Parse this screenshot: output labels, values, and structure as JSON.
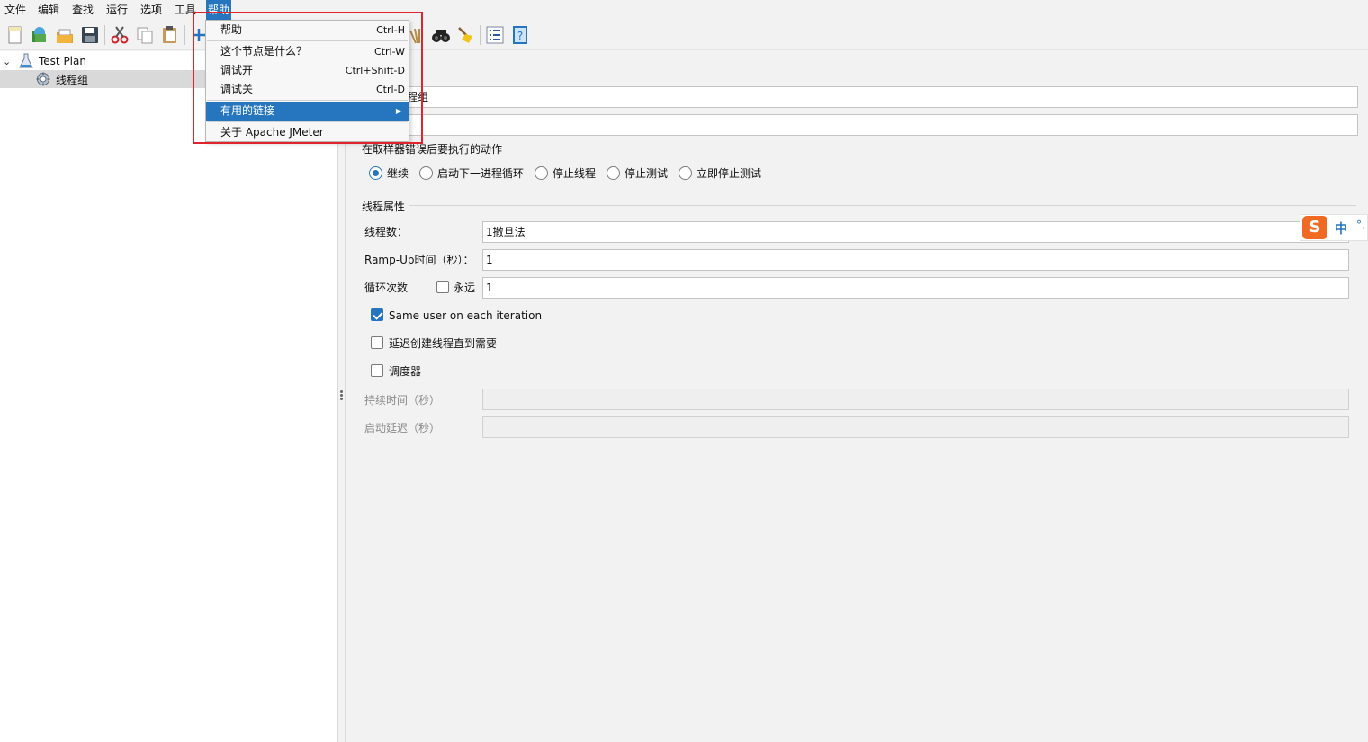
{
  "menubar": {
    "items": [
      "文件",
      "编辑",
      "查找",
      "运行",
      "选项",
      "工具",
      "帮助"
    ]
  },
  "help_menu": {
    "items": [
      {
        "label": "帮助",
        "shortcut": "Ctrl-H"
      },
      {
        "label": "这个节点是什么？",
        "shortcut": "Ctrl-W"
      },
      {
        "label": "调试开",
        "shortcut": "Ctrl+Shift-D"
      },
      {
        "label": "调试关",
        "shortcut": "Ctrl-D"
      },
      {
        "label": "有用的链接",
        "submenu_arrow": "▶"
      },
      {
        "label": "关于 Apache JMeter"
      }
    ]
  },
  "toolbar": {
    "icons": [
      "new-icon",
      "templates-icon",
      "open-icon",
      "save-icon",
      "cut-icon",
      "copy-icon",
      "paste-icon",
      "add-icon",
      "clear-icon",
      "search-icon",
      "clear-all-icon",
      "function-helper-icon",
      "help-icon"
    ]
  },
  "tree": {
    "root": {
      "label": "Test Plan",
      "expander": "⌄"
    },
    "child": {
      "label": "线程组"
    }
  },
  "panel": {
    "name_value_visible": "程组",
    "on_error_title": "在取样器错误后要执行的动作",
    "on_error_options": [
      "继续",
      "启动下一进程循环",
      "停止线程",
      "停止测试",
      "立即停止测试"
    ],
    "selected_option_index": 0,
    "thread_props_title": "线程属性",
    "threads_label": "线程数：",
    "threads_value": "1撒旦法",
    "rampup_label": "Ramp-Up时间（秒）：",
    "rampup_value": "1",
    "loop_label": "循环次数",
    "forever_label": "永远",
    "forever_checked": false,
    "loop_value": "1",
    "same_user_label": "Same user on each iteration",
    "same_user_checked": true,
    "delay_label": "延迟创建线程直到需要",
    "delay_checked": false,
    "scheduler_label": "调度器",
    "scheduler_checked": false,
    "duration_label": "持续时间（秒）",
    "startup_delay_label": "启动延迟（秒）"
  },
  "ime": {
    "logo": "S",
    "mode": "中",
    "punct": "°,"
  },
  "colors": {
    "accent": "#2675bf",
    "highlight_box": "#e0242e"
  }
}
